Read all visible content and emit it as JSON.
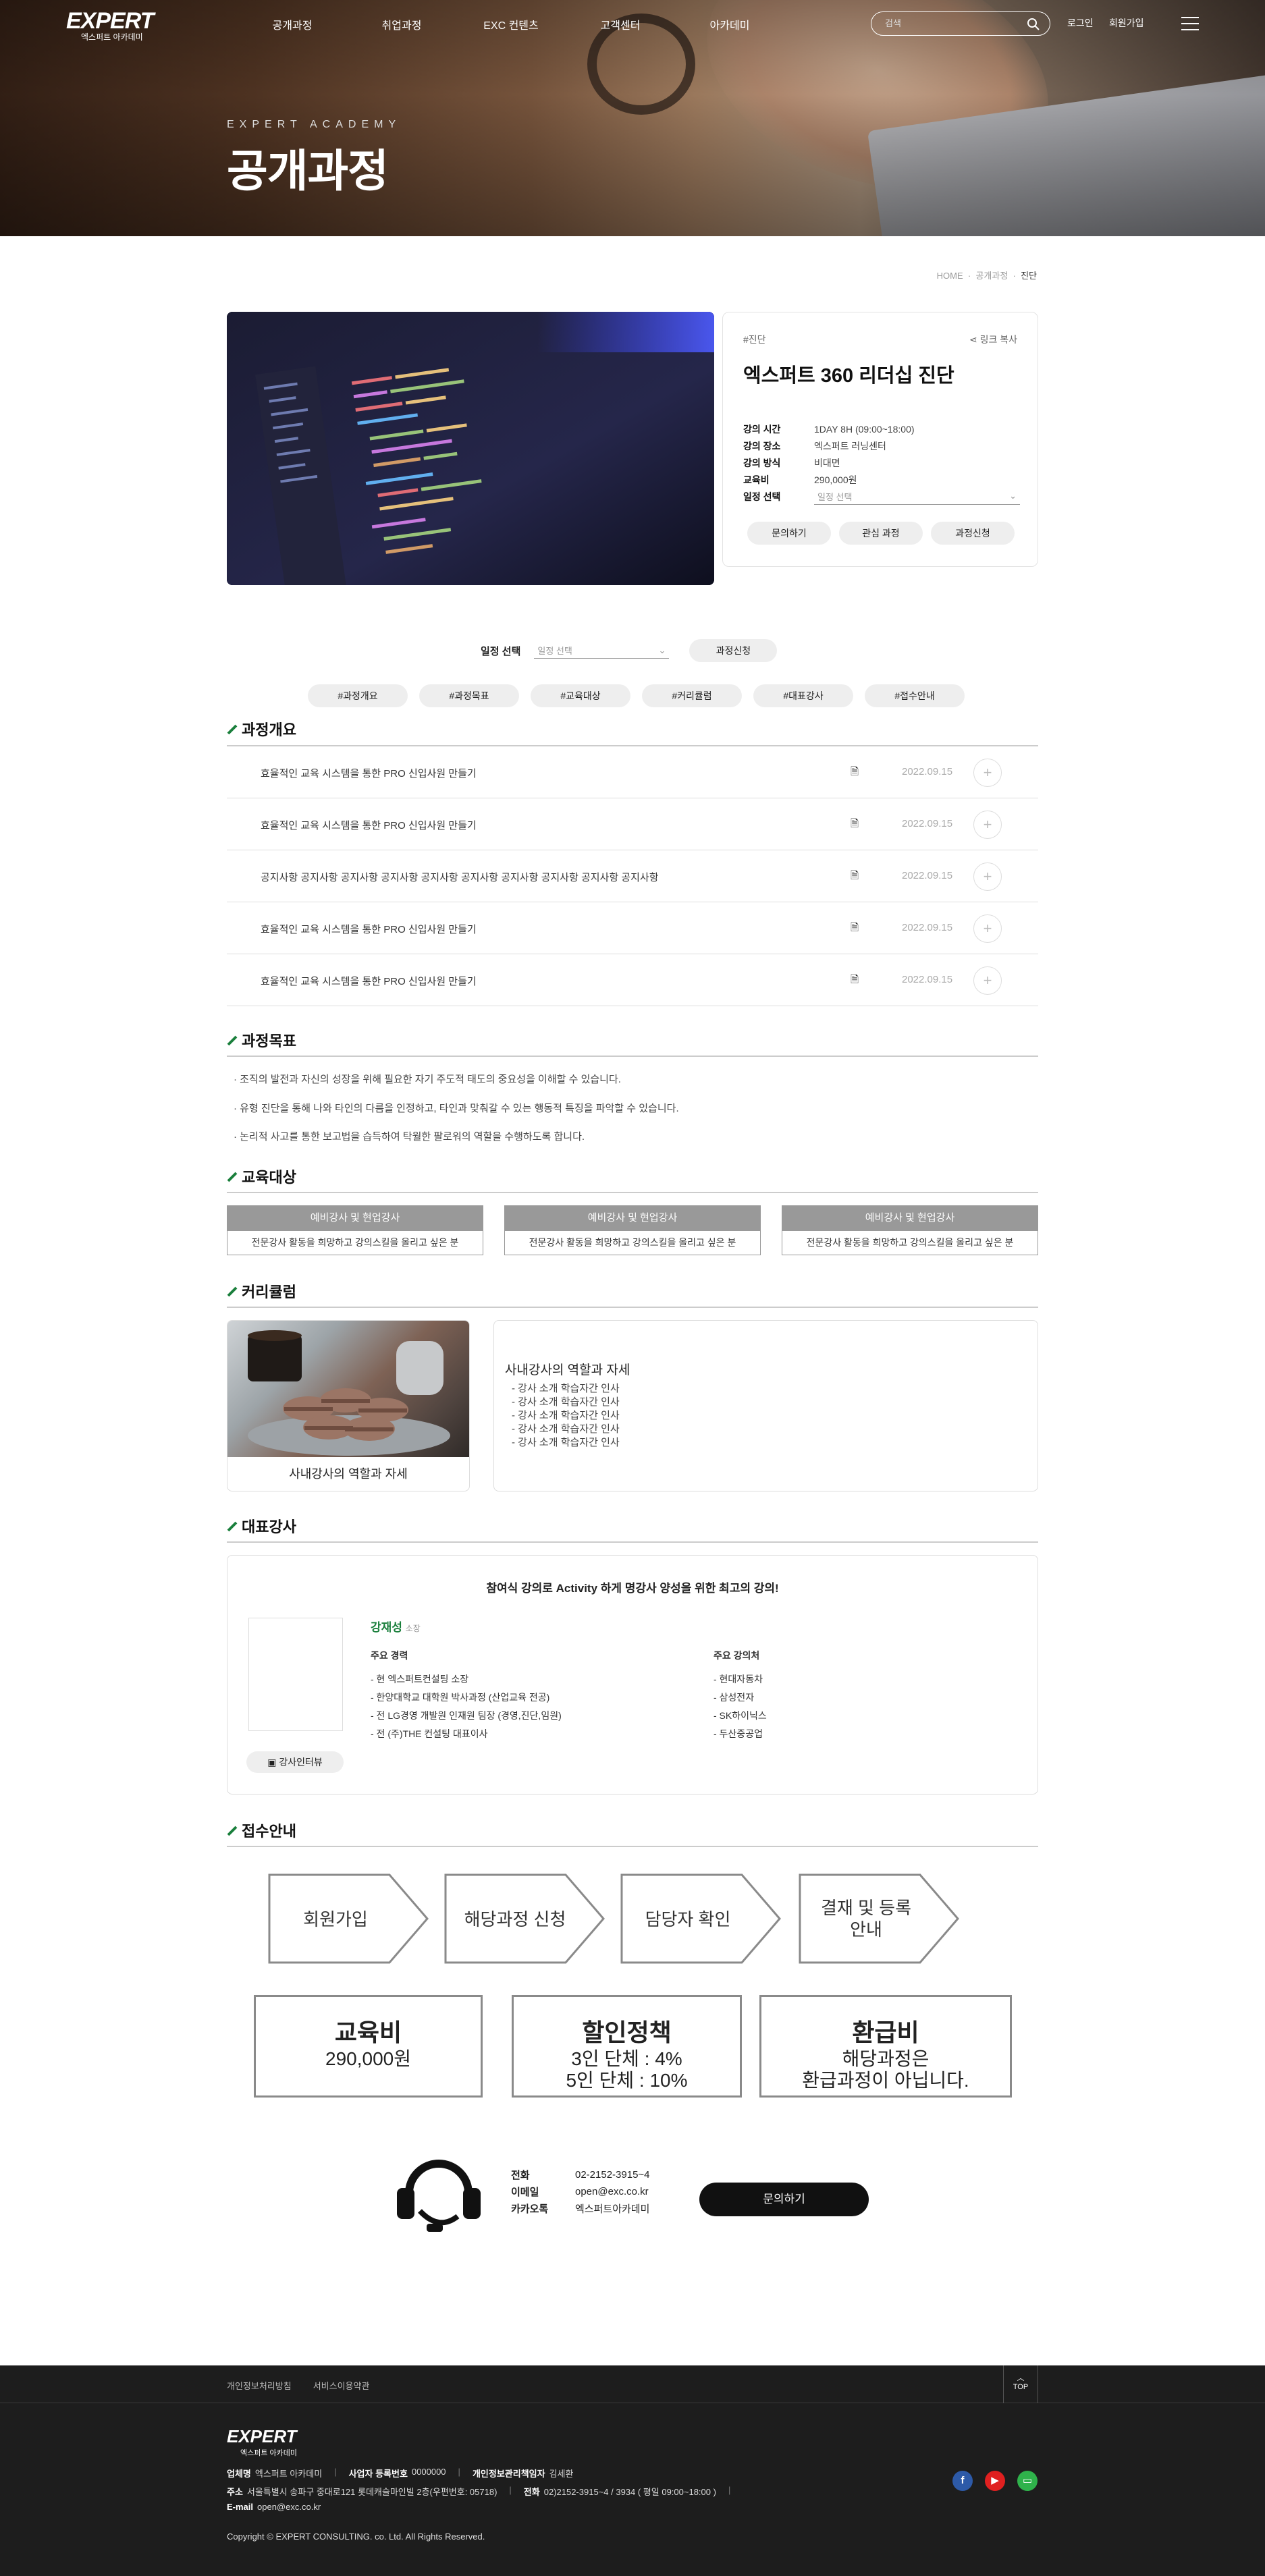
{
  "header": {
    "logo_main": "EXPERT",
    "logo_sub": "엑스퍼트 아카데미",
    "nav": [
      "공개과정",
      "취업과정",
      "EXC 컨텐츠",
      "고객센터",
      "아카데미"
    ],
    "search_placeholder": "검색",
    "login": "로그인",
    "join": "회원가입"
  },
  "hero": {
    "subtitle": "EXPERT ACADEMY",
    "title": "공개과정"
  },
  "breadcrumb": {
    "home": "HOME",
    "cat": "공개과정",
    "current": "진단"
  },
  "course": {
    "tag": "#진단",
    "share": "링크 복사",
    "title": "엑스퍼트 360 리더십 진단",
    "info": [
      {
        "k": "강의 시간",
        "v": "1DAY 8H (09:00~18:00)"
      },
      {
        "k": "강의 장소",
        "v": "엑스퍼트 러닝센터"
      },
      {
        "k": "강의 방식",
        "v": "비대면"
      },
      {
        "k": "교육비",
        "v": "290,000원"
      }
    ],
    "schedule_label": "일정 선택",
    "schedule_placeholder": "일정 선택",
    "buttons": [
      "문의하기",
      "관심 과정",
      "과정신청"
    ]
  },
  "schedule_bar": {
    "label": "일정 선택",
    "placeholder": "일정 선택",
    "apply": "과정신청"
  },
  "tabs": [
    "#과정개요",
    "#과정목표",
    "#교육대상",
    "#커리큘럼",
    "#대표강사",
    "#접수안내"
  ],
  "overview": {
    "title": "과정개요",
    "rows": [
      {
        "title": "효율적인 교육 시스템을 통한 PRO 신입사원 만들기",
        "date": "2022.09.15"
      },
      {
        "title": "효율적인 교육 시스템을 통한 PRO 신입사원 만들기",
        "date": "2022.09.15"
      },
      {
        "title": "공지사항 공지사항 공지사항 공지사항 공지사항 공지사항 공지사항 공지사항 공지사항 공지사항",
        "date": "2022.09.15"
      },
      {
        "title": "효율적인 교육 시스템을 통한 PRO 신입사원 만들기",
        "date": "2022.09.15"
      },
      {
        "title": "효율적인 교육 시스템을 통한 PRO 신입사원 만들기",
        "date": "2022.09.15"
      }
    ]
  },
  "goals": {
    "title": "과정목표",
    "items": [
      "· 조직의 발전과 자신의 성장을 위해 필요한 자기 주도적 태도의 중요성을 이해할 수 있습니다.",
      "· 유형 진단을 통해 나와 타인의 다름을 인정하고, 타인과 맞춰갈 수 있는 행동적 특징을 파악할 수 있습니다.",
      "· 논리적 사고를 통한 보고법을 습득하여 탁월한 팔로워의 역할을 수행하도록 합니다."
    ]
  },
  "target": {
    "title": "교육대상",
    "cards": [
      {
        "h": "예비강사 및 현업강사",
        "b": "전문강사 활동을 희망하고 강의스킬을 올리고 싶은 분"
      },
      {
        "h": "예비강사 및 현업강사",
        "b": "전문강사 활동을 희망하고 강의스킬을 올리고 싶은 분"
      },
      {
        "h": "예비강사 및 현업강사",
        "b": "전문강사 활동을 희망하고 강의스킬을 올리고 싶은 분"
      }
    ]
  },
  "curriculum": {
    "title": "커리큘럼",
    "caption": "사내강사의 역할과 자세",
    "heading": "사내강사의 역할과 자세",
    "items": [
      "- 강사 소개 학습자간 인사",
      "- 강사 소개 학습자간 인사",
      "- 강사 소개 학습자간 인사",
      "- 강사 소개 학습자간 인사",
      "- 강사 소개 학습자간 인사"
    ]
  },
  "lecturer": {
    "title": "대표강사",
    "headline": "참여식 강의로 Activity 하게 명강사 양성을 위한 최고의 강의!",
    "name": "강재성",
    "position": "소장",
    "career_title": "주요 경력",
    "career": [
      "- 현 엑스퍼트컨설팅 소장",
      "- 한양대학교 대학원 박사과정 (산업교육 전공)",
      "- 전 LG경영 개발원 인재원 팀장 (경영,진단,임원)",
      "- 전 (주)THE 컨설팅 대표이사"
    ],
    "clients_title": "주요 강의처",
    "clients": [
      "- 현대자동차",
      "- 삼성전자",
      "- SK하이닉스",
      "- 두산중공업"
    ],
    "interview": "강사인터뷰"
  },
  "reception": {
    "title": "접수안내",
    "steps": [
      "회원가입",
      "해당과정 신청",
      "담당자 확인",
      "결재 및 등록\n안내"
    ],
    "boxes": [
      {
        "title": "교육비",
        "body": "290,000원"
      },
      {
        "title": "할인정책",
        "body": "3인 단체 : 4%\n5인 단체 : 10%"
      },
      {
        "title": "환급비",
        "body": "해당과정은\n환급과정이 아닙니다."
      }
    ]
  },
  "contact": {
    "rows": [
      {
        "k": "전화",
        "v": "02-2152-3915~4"
      },
      {
        "k": "이메일",
        "v": "open@exc.co.kr"
      },
      {
        "k": "카카오톡",
        "v": "엑스퍼트아카데미"
      }
    ],
    "ask": "문의하기"
  },
  "footer": {
    "links": [
      "개인정보처리방침",
      "서비스이용약관"
    ],
    "top": "TOP",
    "logo_main": "EXPERT",
    "logo_sub": "엑스퍼트 아카데미",
    "line1": [
      {
        "k": "업체명",
        "v": "엑스퍼트 아카데미"
      },
      {
        "k": "사업자 등록번호",
        "v": "0000000"
      },
      {
        "k": "개인정보관리책임자",
        "v": "김세환"
      }
    ],
    "line2": [
      {
        "k": "주소",
        "v": "서울특별시 송파구 중대로121 롯데캐슬마인빌 2층(우편번호: 05718)"
      },
      {
        "k": "전화",
        "v": "02)2152-3915~4 / 3934 ( 평일 09:00~18:00 )"
      }
    ],
    "line3": [
      {
        "k": "E-mail",
        "v": "open@exc.co.kr"
      }
    ],
    "copyright": "Copyright © EXPERT CONSULTING. co. Ltd. All Rights Reserved."
  },
  "colors": {
    "accent": "#1a7f3c",
    "dark": "#111111",
    "footer_bg": "#1d1d1d"
  }
}
